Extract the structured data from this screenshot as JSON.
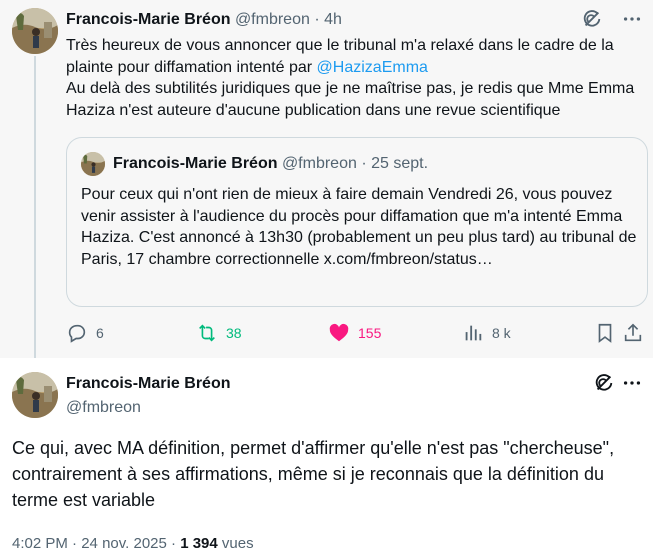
{
  "tweet1": {
    "author_name": "Francois-Marie Bréon",
    "handle": "@fmbreon",
    "time": "4h",
    "text_before_mention": "Très heureux de vous annoncer que le tribunal m'a relaxé dans le cadre de la plainte pour diffamation intenté par ",
    "mention": "@HazizaEmma",
    "text_after_mention": "Au delà des subtilités juridiques que je ne maîtrise pas, je redis que Mme Emma Haziza n'est auteure d'aucune publication dans une revue scientifique",
    "quote": {
      "author_name": "Francois-Marie Bréon",
      "handle": "@fmbreon",
      "date": "25 sept.",
      "text": "Pour ceux qui n'ont rien de mieux à faire demain Vendredi 26, vous pouvez venir assister à l'audience du procès pour diffamation que m'a intenté Emma Haziza.  C'est annoncé à 13h30 (probablement un peu plus tard) au tribunal de Paris, 17 chambre correctionnelle x.com/fmbreon/status…"
    },
    "replies": "6",
    "reposts": "38",
    "likes": "155",
    "views": "8 k"
  },
  "tweet2": {
    "author_name": "Francois-Marie Bréon",
    "handle": "@fmbreon",
    "text": "Ce qui, avec MA définition, permet d'affirmer qu'elle n'est pas \"chercheuse\", contrairement à ses affirmations, même si je reconnais que la définition du terme est variable",
    "time": "4:02 PM",
    "date": "24 nov. 2025",
    "views_count": "1 394",
    "views_label": "vues"
  },
  "colors": {
    "accent": "#1d9bf0",
    "repost_green": "#00ba7c",
    "like_pink": "#f91880",
    "muted": "#536471"
  },
  "icons": [
    "grok-icon",
    "more-icon",
    "reply-icon",
    "repost-icon",
    "like-icon",
    "views-icon",
    "bookmark-icon",
    "share-icon"
  ]
}
